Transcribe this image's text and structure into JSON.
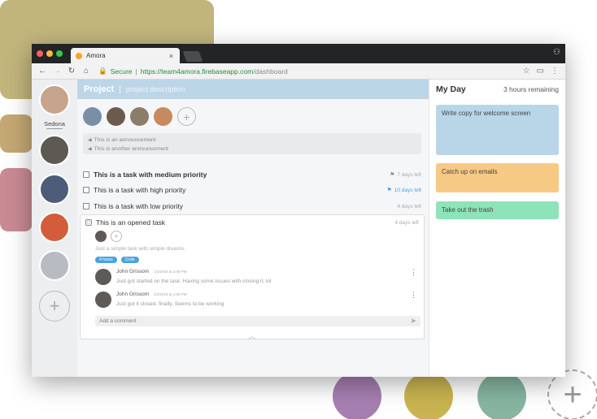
{
  "browser": {
    "tab_title": "Amora",
    "tab_close": "×",
    "secure_label": "Secure",
    "url_scheme_host": "https://team4amora.firebaseapp.com",
    "url_path": "/dashboard"
  },
  "rail": {
    "users": [
      {
        "name": "Sedona",
        "color": "#c7a48c"
      }
    ],
    "projects": [
      {
        "color": "#5e5a53"
      },
      {
        "color": "#4d5c78"
      },
      {
        "color": "#d35d3a"
      },
      {
        "color": "#b8bcc2"
      }
    ],
    "add_label": "+"
  },
  "project": {
    "title": "Project",
    "separator": "|",
    "description": "project description",
    "members": [
      {
        "color": "#7a8fa6"
      },
      {
        "color": "#6b5b4e"
      },
      {
        "color": "#8c7d6b"
      },
      {
        "color": "#c68a5e"
      }
    ],
    "add_member": "+",
    "announcements": [
      "This is an announcement",
      "This is another announcement"
    ]
  },
  "tasks": [
    {
      "name": "This is a task with medium priority",
      "due": "7 days left",
      "flag": "⚑",
      "bold": true,
      "due_color": "#aaaaaa"
    },
    {
      "name": "This is a task with high priority",
      "due": "10 days left",
      "flag": "⚑",
      "bold": false,
      "due_color": "#4a9fe0"
    },
    {
      "name": "This is a task with low priority",
      "due": "4 days left",
      "flag": "",
      "bold": false,
      "due_color": "#aaaaaa"
    }
  ],
  "opened_task": {
    "name": "This is an opened task",
    "due": "4 days left",
    "description": "Just a simple task with simple dreams.",
    "tags": [
      "4 hours",
      "Code"
    ],
    "add_assignee": "+",
    "comments": [
      {
        "author": "John Grissom",
        "date": "1/2/2018 at 2:08 PM",
        "text": "Just got started on the task. Having some issues with closing it, lol"
      },
      {
        "author": "John Grissom",
        "date": "1/2/2018 at 2:08 PM",
        "text": "Just got it closed, finally. Seems to be working"
      }
    ],
    "add_comment_placeholder": "Add a comment",
    "collapse": "︿"
  },
  "my_day": {
    "title": "My Day",
    "remaining": "3 hours remaining",
    "cards": [
      {
        "text": "Write copy for welcome screen",
        "color": "#b8d6e7"
      },
      {
        "text": "Catch up on emails",
        "color": "#f6c985"
      },
      {
        "text": "Take out the trash",
        "color": "#8ee3b9"
      }
    ]
  },
  "decor": {
    "add_label": "+"
  }
}
